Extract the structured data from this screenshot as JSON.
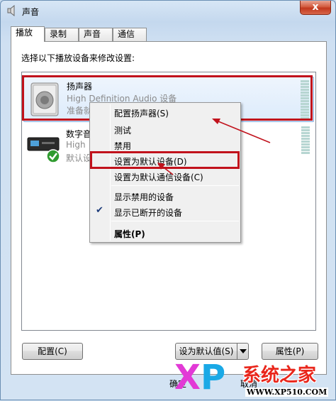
{
  "window": {
    "title": "声音",
    "close_label": "x"
  },
  "tabs": [
    {
      "label": "播放",
      "active": true
    },
    {
      "label": "录制",
      "active": false
    },
    {
      "label": "声音",
      "active": false
    },
    {
      "label": "通信",
      "active": false
    }
  ],
  "instruction": "选择以下播放设备来修改设置:",
  "devices": [
    {
      "name": "扬声器",
      "description": "High Definition Audio 设备",
      "status": "准备就绪",
      "icon": "speaker-icon",
      "selected": true
    },
    {
      "name": "数字音频",
      "description": "High",
      "status": "默认设",
      "icon": "digital-output-icon",
      "default": true
    }
  ],
  "context_menu": {
    "items": [
      {
        "label": "配置扬声器(S)"
      },
      {
        "label": "测试"
      },
      {
        "label": "禁用"
      },
      {
        "label": "设置为默认设备(D)"
      },
      {
        "label": "设置为默认通信设备(C)"
      },
      {
        "label": "显示禁用的设备"
      },
      {
        "label": "显示已断开的设备",
        "checked": true
      },
      {
        "label": "属性(P)",
        "bold": true
      }
    ]
  },
  "buttons": {
    "configure": "配置(C)",
    "set_default": "设为默认值(S)",
    "properties": "属性(P)",
    "ok": "确定",
    "cancel": "取消"
  },
  "watermark": {
    "brand": "系统之家",
    "url": "WWW.XP510.COM",
    "xp_x": "X",
    "xp_p": "P"
  },
  "colors": {
    "highlight_box": "#c1121c",
    "selection": "#dcebfc"
  }
}
